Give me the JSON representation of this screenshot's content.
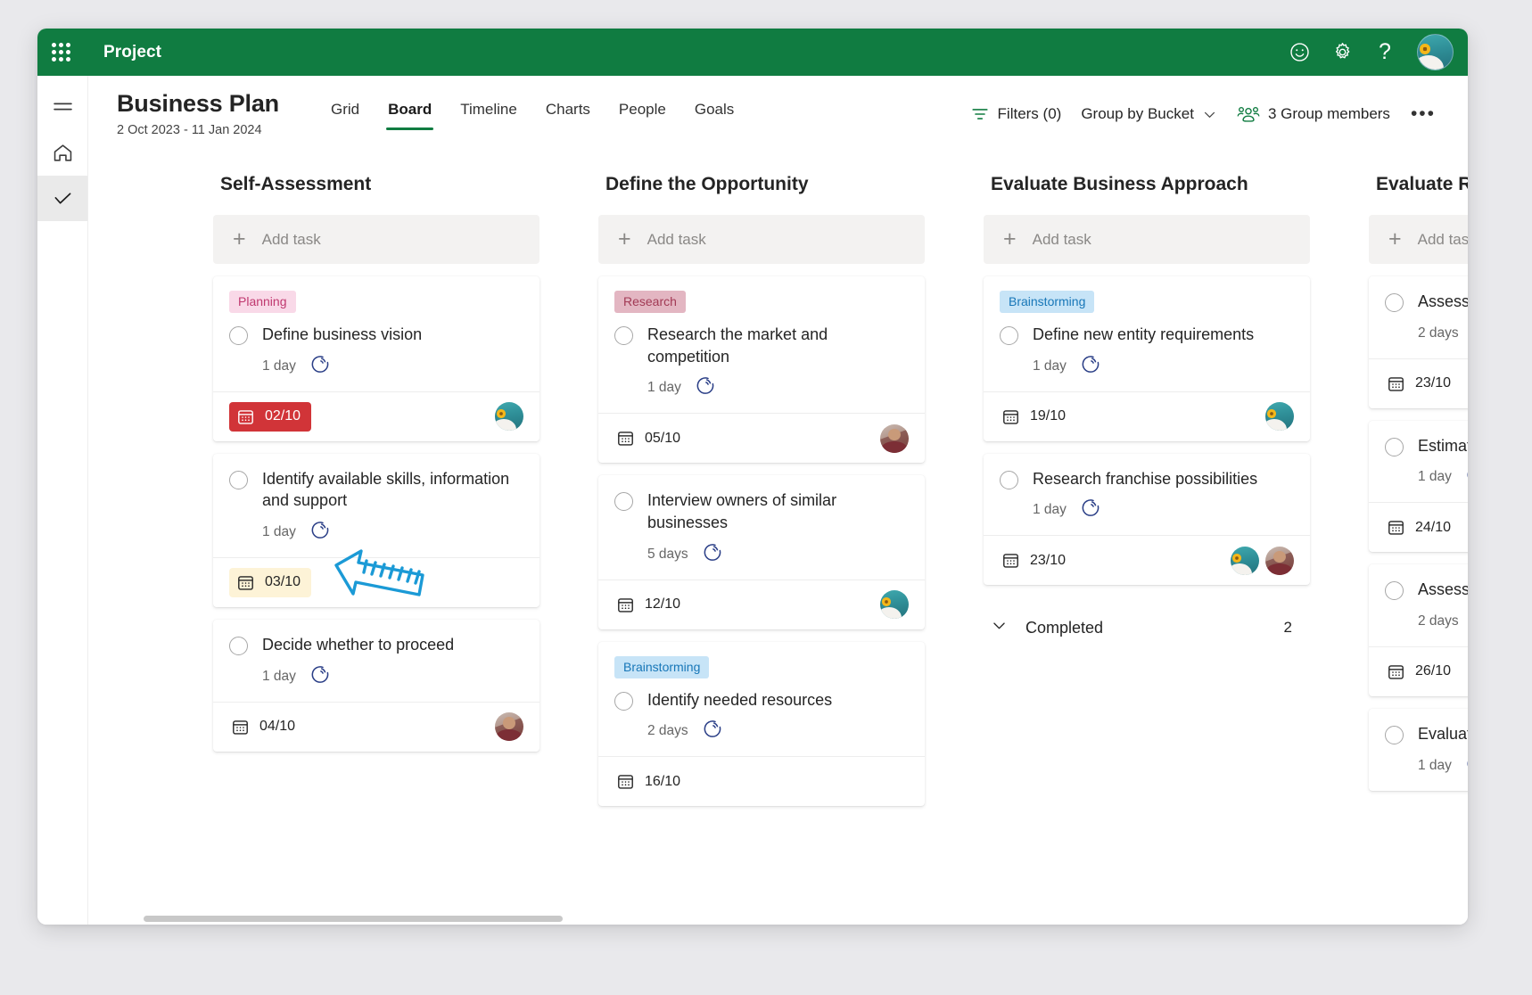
{
  "app": {
    "title": "Project",
    "waffle_icon": "app-launcher-icon",
    "actions": [
      {
        "name": "feedback-smiley-icon",
        "glyph": "smiley"
      },
      {
        "name": "settings-gear-icon",
        "glyph": "gear"
      },
      {
        "name": "help-icon",
        "glyph": "?"
      }
    ],
    "avatar_name": "user-avatar"
  },
  "rail": {
    "items": [
      {
        "name": "hamburger-menu-icon",
        "selected": false
      },
      {
        "name": "home-icon",
        "selected": false
      },
      {
        "name": "tasks-check-icon",
        "selected": true
      }
    ]
  },
  "header": {
    "plan_title": "Business Plan",
    "date_range": "2 Oct 2023 - 11 Jan 2024"
  },
  "tabs": [
    {
      "label": "Grid",
      "active": false
    },
    {
      "label": "Board",
      "active": true
    },
    {
      "label": "Timeline",
      "active": false
    },
    {
      "label": "Charts",
      "active": false
    },
    {
      "label": "People",
      "active": false
    },
    {
      "label": "Goals",
      "active": false
    }
  ],
  "toolbar": {
    "filters_label": "Filters (0)",
    "group_by_label": "Group by Bucket",
    "members_label": "3 Group members",
    "overflow_label": "•••"
  },
  "board": {
    "add_task_label": "Add task",
    "buckets": [
      {
        "title": "Self-Assessment",
        "tasks": [
          {
            "label": "Planning",
            "label_style": "chip-planning",
            "title": "Define business vision",
            "duration": "1 day",
            "date": "02/10",
            "date_style": "date-late",
            "assignees": [
              "ava-teal"
            ]
          },
          {
            "label": null,
            "title": "Identify available skills, information and support",
            "duration": "1 day",
            "date": "03/10",
            "date_style": "date-soon",
            "assignees": []
          },
          {
            "label": null,
            "title": "Decide whether to proceed",
            "duration": "1 day",
            "date": "04/10",
            "date_style": "date-default",
            "assignees": [
              "ava-maroon"
            ]
          }
        ]
      },
      {
        "title": "Define the Opportunity",
        "tasks": [
          {
            "label": "Research",
            "label_style": "chip-research",
            "title": "Research the market and competition",
            "duration": "1 day",
            "date": "05/10",
            "date_style": "date-default",
            "assignees": [
              "ava-maroon"
            ]
          },
          {
            "label": null,
            "title": "Interview owners of similar businesses",
            "duration": "5 days",
            "date": "12/10",
            "date_style": "date-default",
            "assignees": [
              "ava-teal"
            ]
          },
          {
            "label": "Brainstorming",
            "label_style": "chip-brainstorming",
            "title": "Identify needed resources",
            "duration": "2 days",
            "date": "16/10",
            "date_style": "date-default",
            "assignees": []
          }
        ]
      },
      {
        "title": "Evaluate Business Approach",
        "tasks": [
          {
            "label": "Brainstorming",
            "label_style": "chip-brainstorming",
            "title": "Define new entity requirements",
            "duration": "1 day",
            "date": "19/10",
            "date_style": "date-default",
            "assignees": [
              "ava-teal"
            ]
          },
          {
            "label": null,
            "title": "Research franchise possibilities",
            "duration": "1 day",
            "date": "23/10",
            "date_style": "date-default",
            "assignees": [
              "ava-teal",
              "ava-maroon"
            ]
          }
        ],
        "completed": {
          "label": "Completed",
          "count": "2"
        }
      },
      {
        "title": "Evaluate Risks and Rewards",
        "tasks": [
          {
            "label": null,
            "title": "Assess market size and potential",
            "duration": "2 days",
            "date": "23/10",
            "date_style": "date-default",
            "assignees": []
          },
          {
            "label": null,
            "title": "Estimate the competition",
            "duration": "1 day",
            "date": "24/10",
            "date_style": "date-default",
            "assignees": []
          },
          {
            "label": null,
            "title": "Assess needed resource availability",
            "duration": "2 days",
            "date": "26/10",
            "date_style": "date-default",
            "assignees": []
          },
          {
            "label": null,
            "title": "Evaluate realistic initial market share",
            "duration": "1 day",
            "date": "",
            "date_style": "date-default",
            "assignees": []
          }
        ]
      }
    ]
  },
  "annotation": {
    "name": "hand-drawn-arrow",
    "color": "#1b9ad6",
    "points_at": "progress-icon"
  },
  "colors": {
    "brand_green": "#107c41",
    "overdue_red": "#d13438",
    "due_soon_yellow": "#fdf3d7",
    "progress_blue": "#2b3f87"
  }
}
